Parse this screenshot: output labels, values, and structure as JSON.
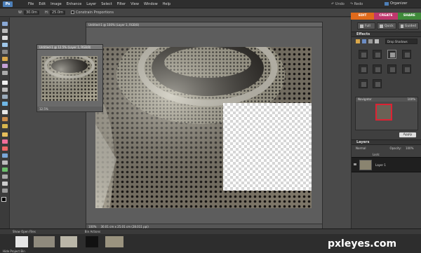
{
  "menu": {
    "logo": "Ps",
    "items": [
      "File",
      "Edit",
      "Image",
      "Enhance",
      "Layer",
      "Select",
      "Filter",
      "View",
      "Window",
      "Help"
    ],
    "undo": "Undo",
    "redo": "Redo",
    "organizer": "Organizer"
  },
  "options": {
    "w_label": "W:",
    "w_value": "30.0m",
    "h_label": "H:",
    "h_value": "25.0m",
    "constrain": "Constrain Proportions"
  },
  "mode_tabs": [
    {
      "label": "EDIT",
      "color": "#e06a1b"
    },
    {
      "label": "CREATE",
      "color": "#c0376d"
    },
    {
      "label": "SHARE",
      "color": "#3f8a3a"
    }
  ],
  "edit_modes": [
    "Full",
    "Quick",
    "Guided"
  ],
  "effects": {
    "title": "Effects",
    "dropdown": "Drop Shadows"
  },
  "navigator": {
    "title": "Navigator",
    "zoom": "100%"
  },
  "apply_button": "Apply",
  "layers": {
    "title": "Layers",
    "blend": "Normal",
    "opacity_label": "Opacity:",
    "opacity_value": "100%",
    "lock_label": "Lock:",
    "layer_name": "Layer 1"
  },
  "main_doc": {
    "title": "Untitled-1 @ 100% (Layer 1, RGB/8)",
    "zoom": "100%",
    "info": "30.01 cm x 25.01 cm (28.011 ppi)"
  },
  "nav_doc": {
    "title": "Untitled-1 @ 12.5% (Layer 1, RGB/8)",
    "zoom": "12.5%"
  },
  "bin": {
    "show_open": "Show Open Files",
    "bin_actions": "Bin Actions",
    "hide": "Hide Project Bin"
  },
  "watermark": "pxleyes.com"
}
